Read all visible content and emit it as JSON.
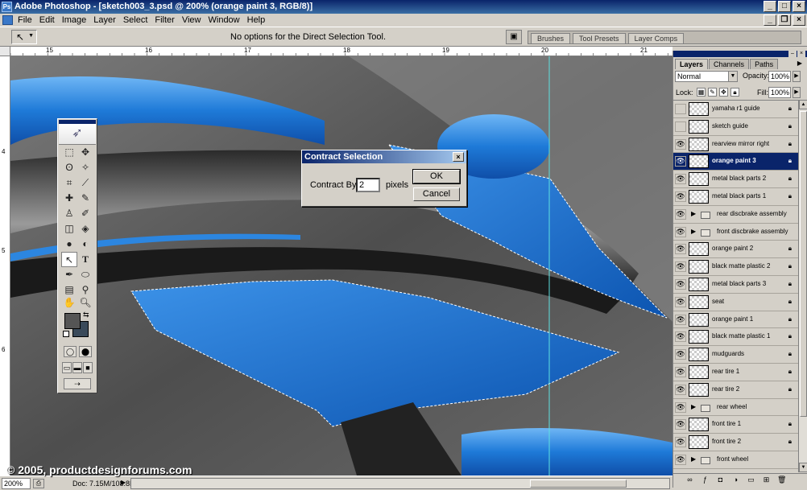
{
  "window": {
    "title": "Adobe Photoshop - [sketch003_3.psd @ 200% (orange paint 3, RGB/8)]",
    "logo_glyph": "Ps"
  },
  "menu": [
    "File",
    "Edit",
    "Image",
    "Layer",
    "Select",
    "Filter",
    "View",
    "Window",
    "Help"
  ],
  "options_bar": {
    "message": "No options for the Direct Selection Tool.",
    "palette_well_tabs": [
      "Brushes",
      "Tool Presets",
      "Layer Comps"
    ]
  },
  "ruler": {
    "top_labels": [
      "15",
      "16",
      "17",
      "18",
      "19",
      "20",
      "21"
    ],
    "left_labels": [
      "4",
      "5",
      "6"
    ]
  },
  "dialog": {
    "title": "Contract Selection",
    "label": "Contract By:",
    "value": "2",
    "unit": "pixels",
    "ok": "OK",
    "cancel": "Cancel"
  },
  "layers_panel": {
    "tabs": [
      "Layers",
      "Channels",
      "Paths"
    ],
    "blend_mode": "Normal",
    "opacity_label": "Opacity:",
    "opacity": "100%",
    "lock_label": "Lock:",
    "fill_label": "Fill:",
    "fill": "100%",
    "layers": [
      {
        "name": "yamaha r1 guide",
        "visible": false,
        "type": "layer",
        "locked": true
      },
      {
        "name": "sketch guide",
        "visible": false,
        "type": "layer",
        "locked": true
      },
      {
        "name": "rearview mirror right",
        "visible": true,
        "type": "layer",
        "locked": true
      },
      {
        "name": "orange paint 3",
        "visible": true,
        "type": "layer",
        "locked": true,
        "active": true
      },
      {
        "name": "metal black parts 2",
        "visible": true,
        "type": "layer",
        "locked": true
      },
      {
        "name": "metal black parts 1",
        "visible": true,
        "type": "layer",
        "locked": true
      },
      {
        "name": "rear discbrake assembly",
        "visible": true,
        "type": "group",
        "locked": false
      },
      {
        "name": "front discbrake assembly",
        "visible": true,
        "type": "group",
        "locked": false
      },
      {
        "name": "orange paint 2",
        "visible": true,
        "type": "layer",
        "locked": true
      },
      {
        "name": "black matte plastic 2",
        "visible": true,
        "type": "layer",
        "locked": true
      },
      {
        "name": "metal black parts 3",
        "visible": true,
        "type": "layer",
        "locked": true
      },
      {
        "name": "seat",
        "visible": true,
        "type": "layer",
        "locked": true
      },
      {
        "name": "orange paint 1",
        "visible": true,
        "type": "layer",
        "locked": true
      },
      {
        "name": "black matte plastic 1",
        "visible": true,
        "type": "layer",
        "locked": true
      },
      {
        "name": "mudguards",
        "visible": true,
        "type": "layer",
        "locked": true
      },
      {
        "name": "rear tire 1",
        "visible": true,
        "type": "layer",
        "locked": true
      },
      {
        "name": "rear tire 2",
        "visible": true,
        "type": "layer",
        "locked": true
      },
      {
        "name": "rear wheel",
        "visible": true,
        "type": "group",
        "locked": false
      },
      {
        "name": "front tire 1",
        "visible": true,
        "type": "layer",
        "locked": true
      },
      {
        "name": "front tire 2",
        "visible": true,
        "type": "layer",
        "locked": true
      },
      {
        "name": "front wheel",
        "visible": true,
        "type": "group",
        "locked": false
      }
    ]
  },
  "status_bar": {
    "zoom": "200%",
    "doc_info": "Doc: 7.15M/108.8M"
  },
  "watermark": "© 2005, productdesignforums.com",
  "colors": {
    "title_blue": "#0a246a",
    "paint_blue": "#1e6fd0",
    "chrome_gray": "#d4d0c8"
  }
}
